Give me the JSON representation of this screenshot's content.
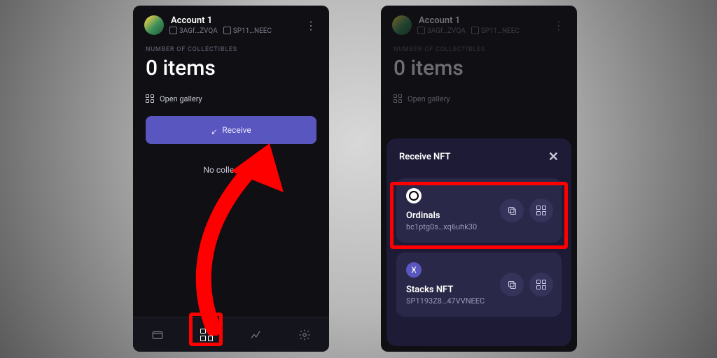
{
  "account": {
    "name": "Account 1",
    "addr1": "3AGf…ZVQA",
    "addr2": "SP11…NEEC"
  },
  "collectibles": {
    "label": "NUMBER OF COLLECTIBLES",
    "count": "0 items",
    "open_gallery": "Open gallery",
    "receive": "Receive",
    "empty": "No collectibles"
  },
  "sheet": {
    "title": "Receive NFT",
    "options": [
      {
        "name": "Ordinals",
        "addr": "bc1ptg0s…xq6uhk30"
      },
      {
        "name": "Stacks NFT",
        "addr": "SP1193Z8…47VVNEEC"
      }
    ]
  },
  "colors": {
    "accent": "#5a56bf",
    "annotate": "#f00"
  },
  "icons": {
    "wallet": "wallet",
    "grid": "grid",
    "chart": "chart",
    "gear": "gear",
    "copy": "copy",
    "qr": "qr",
    "close": "close",
    "more": "more"
  }
}
